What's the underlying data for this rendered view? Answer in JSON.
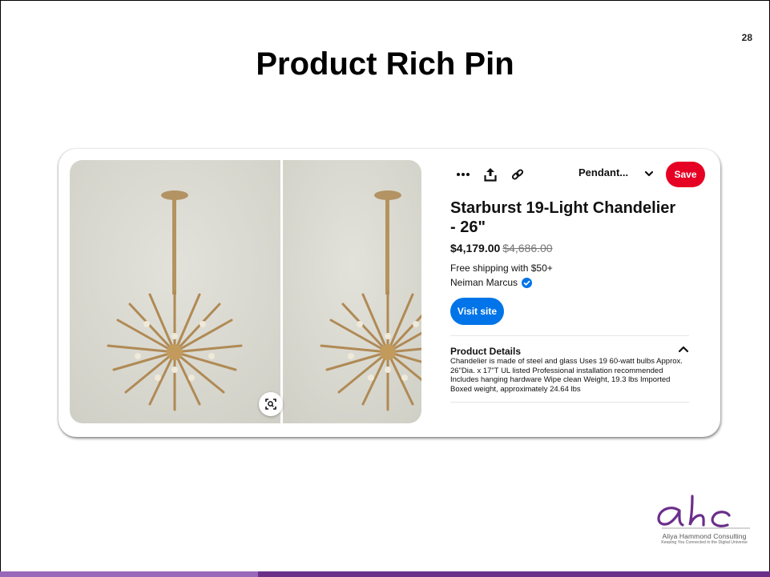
{
  "slide": {
    "page_number": "28",
    "title": "Product Rich Pin"
  },
  "pin": {
    "toolbar": {
      "board": "Pendant...",
      "save_label": "Save"
    },
    "product_title": "Starburst 19-Light Chandelier - 26\"",
    "price": "$4,179.00",
    "original_price": "$4,686.00",
    "shipping": "Free shipping with $50+",
    "merchant": "Neiman Marcus",
    "visit_label": "Visit site",
    "details_heading": "Product Details",
    "details_text": "Chandelier is made of steel and glass Uses 19 60-watt bulbs Approx. 26\"Dia. x 17\"T UL listed Professional installation recommended Includes hanging hardware Wipe clean Weight, 19.3 lbs Imported Boxed weight, approximately 24.64 lbs"
  },
  "logo": {
    "letters": "ahc",
    "name": "Aliya Hammond Consulting",
    "tagline": "Keeping You Connected in the Digital Universe"
  },
  "colors": {
    "save": "#e60023",
    "visit": "#0074e8",
    "verified": "#0074e8",
    "logo_purple": "#6b2f8a",
    "footer_light": "#9a68b8",
    "footer_dark": "#6b2f8a"
  },
  "icons": [
    "more-icon",
    "share-icon",
    "link-icon",
    "chevron-down-icon",
    "verified-icon",
    "chevron-up-icon",
    "visual-search-icon"
  ]
}
